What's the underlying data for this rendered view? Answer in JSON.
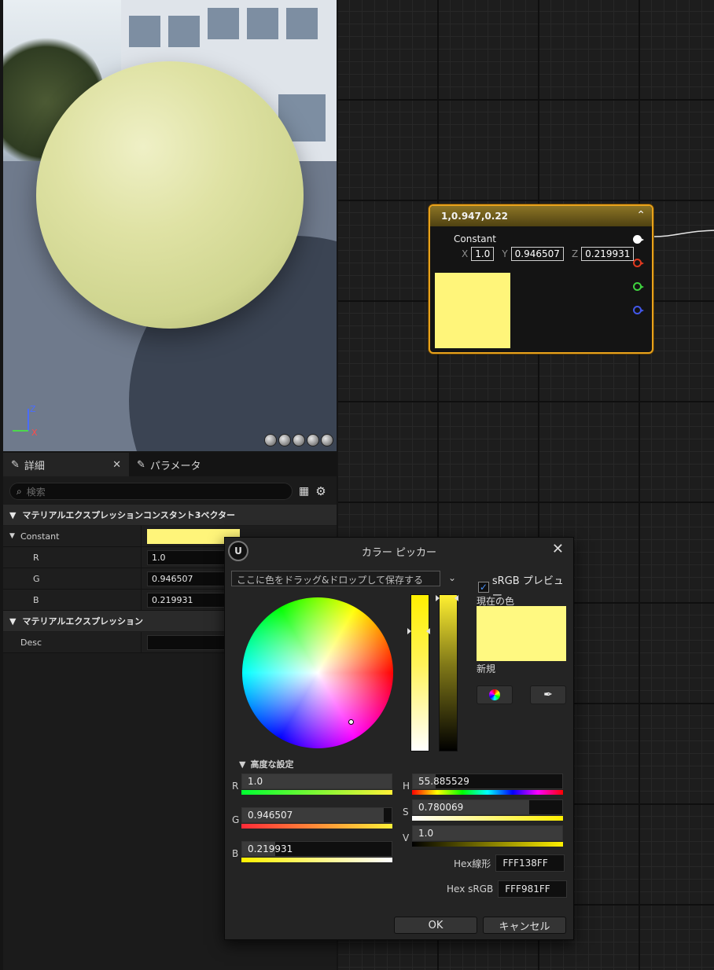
{
  "node": {
    "title": "1,0.947,0.22",
    "constant_label": "Constant",
    "x_label": "X",
    "x_value": "1.0",
    "y_label": "Y",
    "y_value": "0.946507",
    "z_label": "Z",
    "z_value": "0.219931",
    "swatch_color": "#fff57a",
    "pins": [
      {
        "name": "output-pin",
        "color": "#ffffff"
      },
      {
        "name": "r-pin",
        "color": "#e0391f"
      },
      {
        "name": "g-pin",
        "color": "#3fd23f"
      },
      {
        "name": "b-pin",
        "color": "#4257e8"
      }
    ]
  },
  "details": {
    "tab_details": "詳細",
    "tab_params": "パラメータ",
    "search_placeholder": "検索",
    "section1": "マテリアルエクスプレッションコンスタント3ベクター",
    "constant_label": "Constant",
    "constant_color": "#fff57a",
    "r_label": "R",
    "r_value": "1.0",
    "g_label": "G",
    "g_value": "0.946507",
    "b_label": "B",
    "b_value": "0.219931",
    "section2": "マテリアルエクスプレッション",
    "desc_label": "Desc"
  },
  "picker": {
    "title": "カラー ピッカー",
    "drop_text": "ここに色をドラッグ&ドロップして保存する",
    "srgb_label": "sRGB プレビュー",
    "srgb_checked": true,
    "current_label": "現在の色",
    "new_label": "新規",
    "current_color": "#fff981",
    "advanced_label": "高度な設定",
    "r": {
      "label": "R",
      "value": "1.0",
      "fraction": 1.0
    },
    "g": {
      "label": "G",
      "value": "0.946507",
      "fraction": 0.946507
    },
    "b": {
      "label": "B",
      "value": "0.219931",
      "fraction": 0.219931
    },
    "h": {
      "label": "H",
      "value": "55.885529",
      "fraction": 0.155
    },
    "s": {
      "label": "S",
      "value": "0.780069",
      "fraction": 0.780069
    },
    "v": {
      "label": "V",
      "value": "1.0",
      "fraction": 1.0
    },
    "hex_linear_label": "Hex線形",
    "hex_linear": "FFF138FF",
    "hex_srgb_label": "Hex sRGB",
    "hex_srgb": "FFF981FF",
    "ok": "OK",
    "cancel": "キャンセル"
  }
}
